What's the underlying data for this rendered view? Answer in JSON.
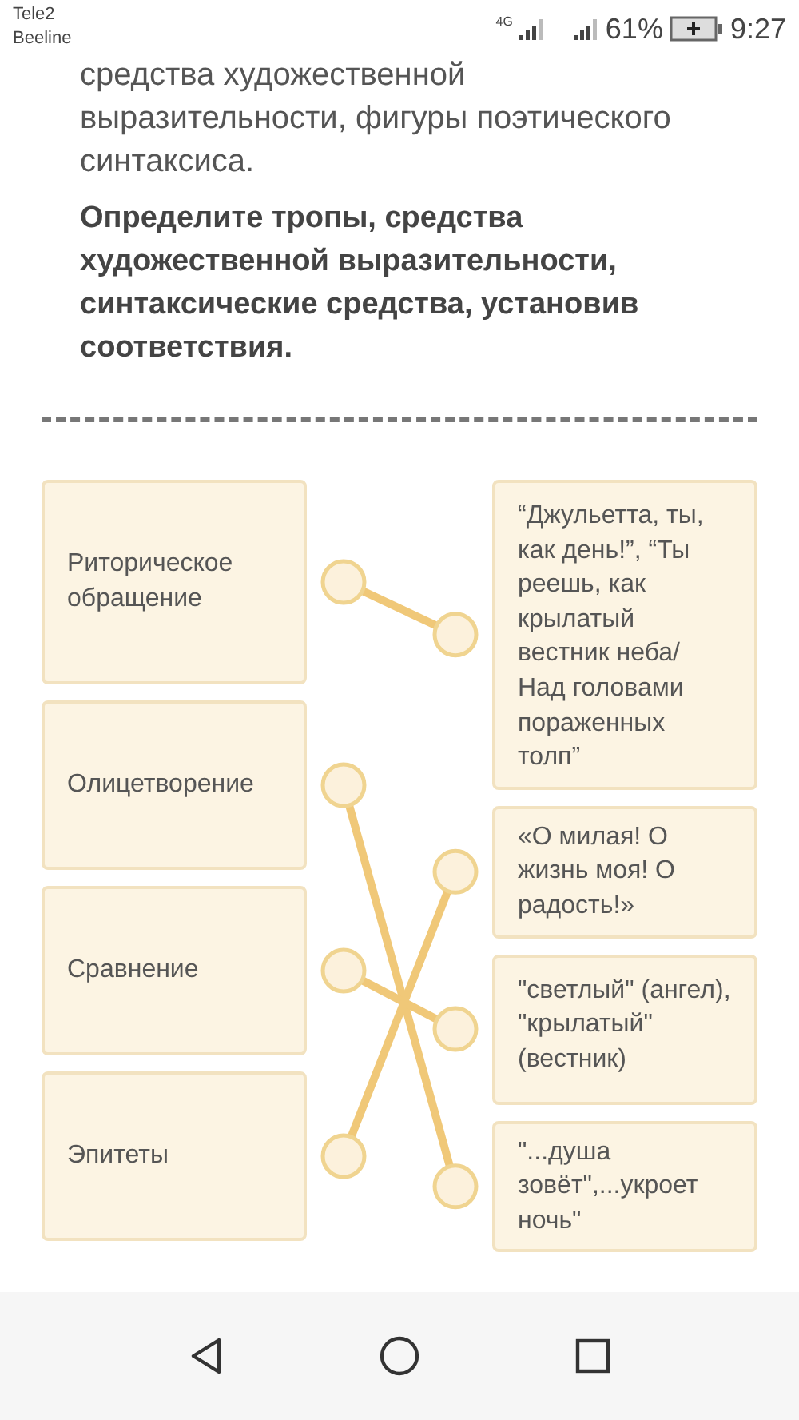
{
  "status_bar": {
    "carriers": [
      "Tele2",
      "Beeline"
    ],
    "network": "4G",
    "battery": "61%",
    "time": "9:27"
  },
  "intro": "средства художественной выразительности, фигуры поэтического синтаксиса.",
  "question": "Определите тропы, средства художественной выразительности, синтаксические средства, установив соответствия.",
  "left_items": [
    {
      "text": "Риторическое обращение",
      "connected": true
    },
    {
      "text": "Олицетворение",
      "connected": true
    },
    {
      "text": "Сравнение",
      "connected": true
    },
    {
      "text": "Эпитеты",
      "connected": true
    }
  ],
  "right_items": [
    {
      "text": "“Джульетта, ты, как день!”, “Ты реешь, как крылатый вестник неба/ Над головами пораженных толп”"
    },
    {
      "text": "«О милая! О жизнь моя! О радость!»"
    },
    {
      "text": "\"светлый\" (ангел), \"крылатый\" (вестник)"
    },
    {
      "text": "\"...душа зовёт\",...укроет ночь\""
    }
  ]
}
